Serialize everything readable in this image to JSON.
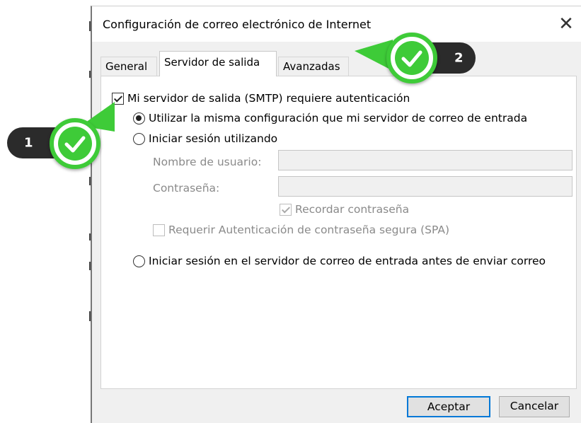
{
  "dialog": {
    "title": "Configuración de correo electrónico de Internet",
    "close_glyph": "✕"
  },
  "tabs": [
    {
      "label": "General",
      "active": false
    },
    {
      "label": "Servidor de salida",
      "active": true
    },
    {
      "label": "Avanzadas",
      "active": false
    }
  ],
  "options": {
    "smtp_auth": {
      "label": "Mi servidor de salida (SMTP) requiere autenticación",
      "checked": true
    },
    "same_config": {
      "label": "Utilizar la misma configuración que mi servidor de correo de entrada",
      "selected": true
    },
    "login_using": {
      "label": "Iniciar sesión utilizando",
      "selected": false
    },
    "username": {
      "label": "Nombre de usuario:",
      "value": ""
    },
    "password": {
      "label": "Contraseña:",
      "value": ""
    },
    "remember_password": {
      "label": "Recordar contraseña",
      "checked": true
    },
    "spa": {
      "label": "Requerir Autenticación de contraseña segura (SPA)",
      "checked": false
    },
    "login_before_send": {
      "label": "Iniciar sesión en el servidor de correo de entrada antes de enviar correo",
      "selected": false
    }
  },
  "buttons": {
    "accept": "Aceptar",
    "cancel": "Cancelar"
  },
  "callouts": [
    {
      "number": "1",
      "icon": "checkmark-icon",
      "color": "#3ecb38"
    },
    {
      "number": "2",
      "icon": "checkmark-icon",
      "color": "#3ecb38"
    }
  ]
}
